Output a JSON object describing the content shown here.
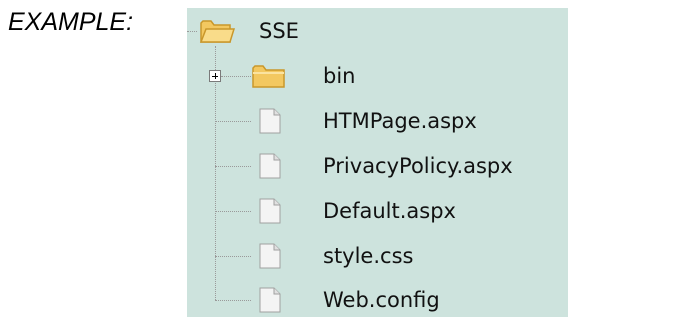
{
  "label": "EXAMPLE:",
  "tree": {
    "root": {
      "name": "SSE",
      "icon": "folder-open-icon"
    },
    "children": [
      {
        "name": "bin",
        "icon": "folder-icon",
        "expandable": true
      },
      {
        "name": "HTMPage.aspx",
        "icon": "file-icon"
      },
      {
        "name": "PrivacyPolicy.aspx",
        "icon": "file-icon"
      },
      {
        "name": "Default.aspx",
        "icon": "file-icon"
      },
      {
        "name": "style.css",
        "icon": "file-icon"
      },
      {
        "name": "Web.config",
        "icon": "file-icon"
      }
    ]
  },
  "colors": {
    "panel_background": "#cde3dd",
    "folder_fill": "#f6d47a",
    "folder_stroke": "#c9972a",
    "file_fill": "#f4f4f4",
    "file_stroke": "#a0a0a0"
  }
}
